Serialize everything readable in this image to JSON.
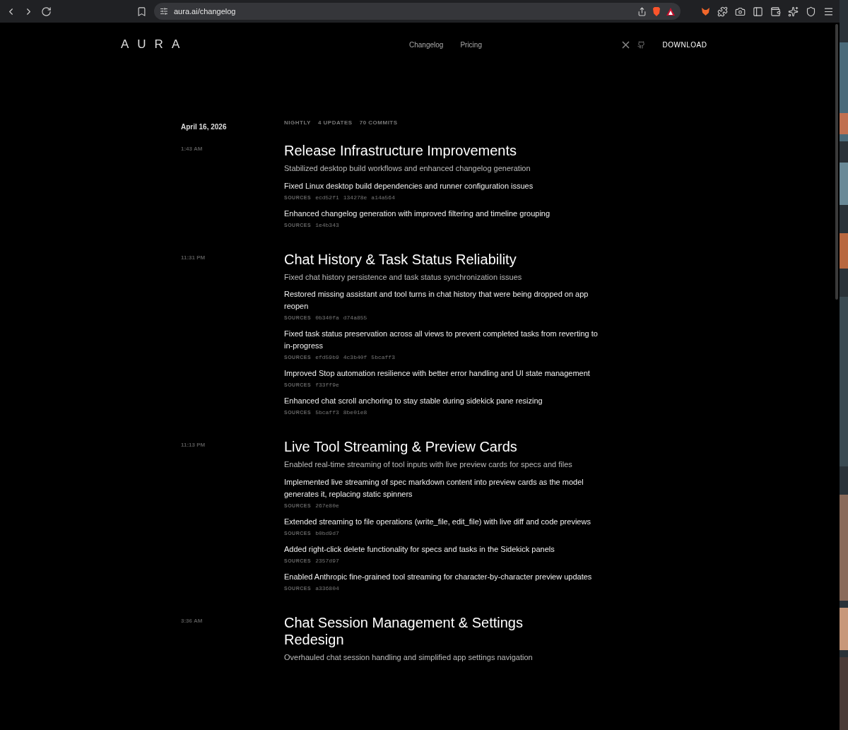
{
  "browser": {
    "url": "aura.ai/changelog"
  },
  "nav": {
    "logo": "AURA",
    "links": [
      "Changelog",
      "Pricing"
    ],
    "download": "DOWNLOAD"
  },
  "release": {
    "date": "April 16, 2026",
    "meta": [
      "NIGHTLY",
      "4 UPDATES",
      "70 COMMITS"
    ],
    "entries": [
      {
        "time": "1:43 AM",
        "title": "Release Infrastructure Improvements",
        "summary": "Stabilized desktop build workflows and enhanced changelog generation",
        "items": [
          {
            "text": "Fixed Linux desktop build dependencies and runner configuration issues",
            "sources_label": "SOURCES",
            "commits": [
              "ecd52f1",
              "134278e",
              "a14a564"
            ]
          },
          {
            "text": "Enhanced changelog generation with improved filtering and timeline grouping",
            "sources_label": "SOURCES",
            "commits": [
              "1e4b343"
            ]
          }
        ]
      },
      {
        "time": "11:31 PM",
        "title": "Chat History & Task Status Reliability",
        "summary": "Fixed chat history persistence and task status synchronization issues",
        "items": [
          {
            "text": "Restored missing assistant and tool turns in chat history that were being dropped on app reopen",
            "sources_label": "SOURCES",
            "commits": [
              "0b340fa",
              "d74a855"
            ]
          },
          {
            "text": "Fixed task status preservation across all views to prevent completed tasks from reverting to in-progress",
            "sources_label": "SOURCES",
            "commits": [
              "efd59b9",
              "4c3b40f",
              "5bcaff3"
            ]
          },
          {
            "text": "Improved Stop automation resilience with better error handling and UI state management",
            "sources_label": "SOURCES",
            "commits": [
              "f33ff9e"
            ]
          },
          {
            "text": "Enhanced chat scroll anchoring to stay stable during sidekick pane resizing",
            "sources_label": "SOURCES",
            "commits": [
              "5bcaff3",
              "8be01e8"
            ]
          }
        ]
      },
      {
        "time": "11:13 PM",
        "title": "Live Tool Streaming & Preview Cards",
        "summary": "Enabled real-time streaming of tool inputs with live preview cards for specs and files",
        "items": [
          {
            "text": "Implemented live streaming of spec markdown content into preview cards as the model generates it, replacing static spinners",
            "sources_label": "SOURCES",
            "commits": [
              "267e80e"
            ]
          },
          {
            "text": "Extended streaming to file operations (write_file, edit_file) with live diff and code previews",
            "sources_label": "SOURCES",
            "commits": [
              "b0bd9d7"
            ]
          },
          {
            "text": "Added right-click delete functionality for specs and tasks in the Sidekick panels",
            "sources_label": "SOURCES",
            "commits": [
              "2357d97"
            ]
          },
          {
            "text": "Enabled Anthropic fine-grained tool streaming for character-by-character preview updates",
            "sources_label": "SOURCES",
            "commits": [
              "a336804"
            ]
          }
        ]
      },
      {
        "time": "3:36 AM",
        "title": "Chat Session Management & Settings Redesign",
        "summary": "Overhauled chat session handling and simplified app settings navigation"
      }
    ]
  }
}
